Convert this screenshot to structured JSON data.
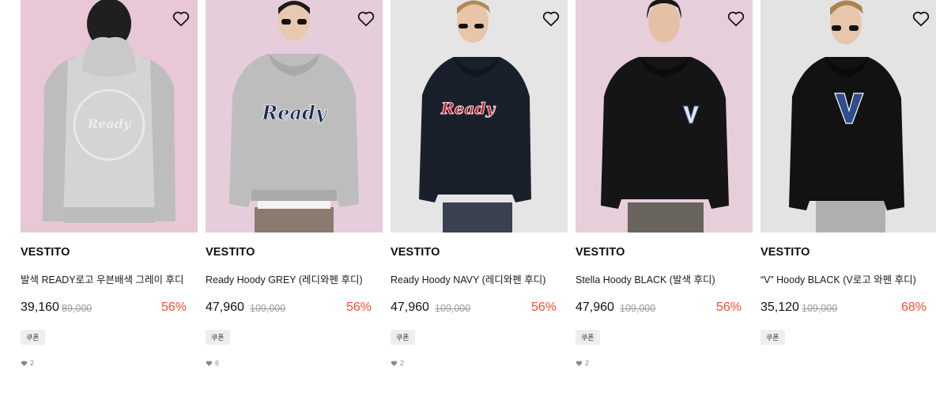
{
  "products": [
    {
      "brand": "VESTITO",
      "name": "발색 READY로고 우븐배색 그레이 후디",
      "price": "39,160",
      "original_price": "89,000",
      "discount": "56%",
      "coupon": "쿠폰",
      "likes": "2",
      "bg_color": "#e8c7d6",
      "garment": "grey-back",
      "graphic": "Ready"
    },
    {
      "brand": "VESTITO",
      "name": "Ready Hoody GREY (레디와펜 후디)",
      "price": "47,960",
      "original_price": "109,000",
      "discount": "56%",
      "coupon": "쿠폰",
      "likes": "6",
      "bg_color": "#e6cddb",
      "garment": "grey-front",
      "graphic": "Ready"
    },
    {
      "brand": "VESTITO",
      "name": "Ready Hoody NAVY (레디와펜 후디)",
      "price": "47,960",
      "original_price": "109,000",
      "discount": "56%",
      "coupon": "쿠폰",
      "likes": "2",
      "bg_color": "#e5e5e5",
      "garment": "navy-front",
      "graphic": "Ready"
    },
    {
      "brand": "VESTITO",
      "name": "Stella Hoody BLACK (발색 후디)",
      "price": "47,960",
      "original_price": "109,000",
      "discount": "56%",
      "coupon": "쿠폰",
      "likes": "2",
      "bg_color": "#e6cfdb",
      "garment": "black-small-v",
      "graphic": "V"
    },
    {
      "brand": "VESTITO",
      "name": "“V” Hoody BLACK (V로고 와펜 후디)",
      "price": "35,120",
      "original_price": "109,000",
      "discount": "68%",
      "coupon": "쿠폰",
      "likes": "",
      "bg_color": "#e3e3e3",
      "garment": "black-big-v",
      "graphic": "V"
    }
  ],
  "colors": {
    "discount": "#ff4b2b",
    "original_price": "#9a9a9a",
    "coupon_bg": "#eeeeee"
  }
}
